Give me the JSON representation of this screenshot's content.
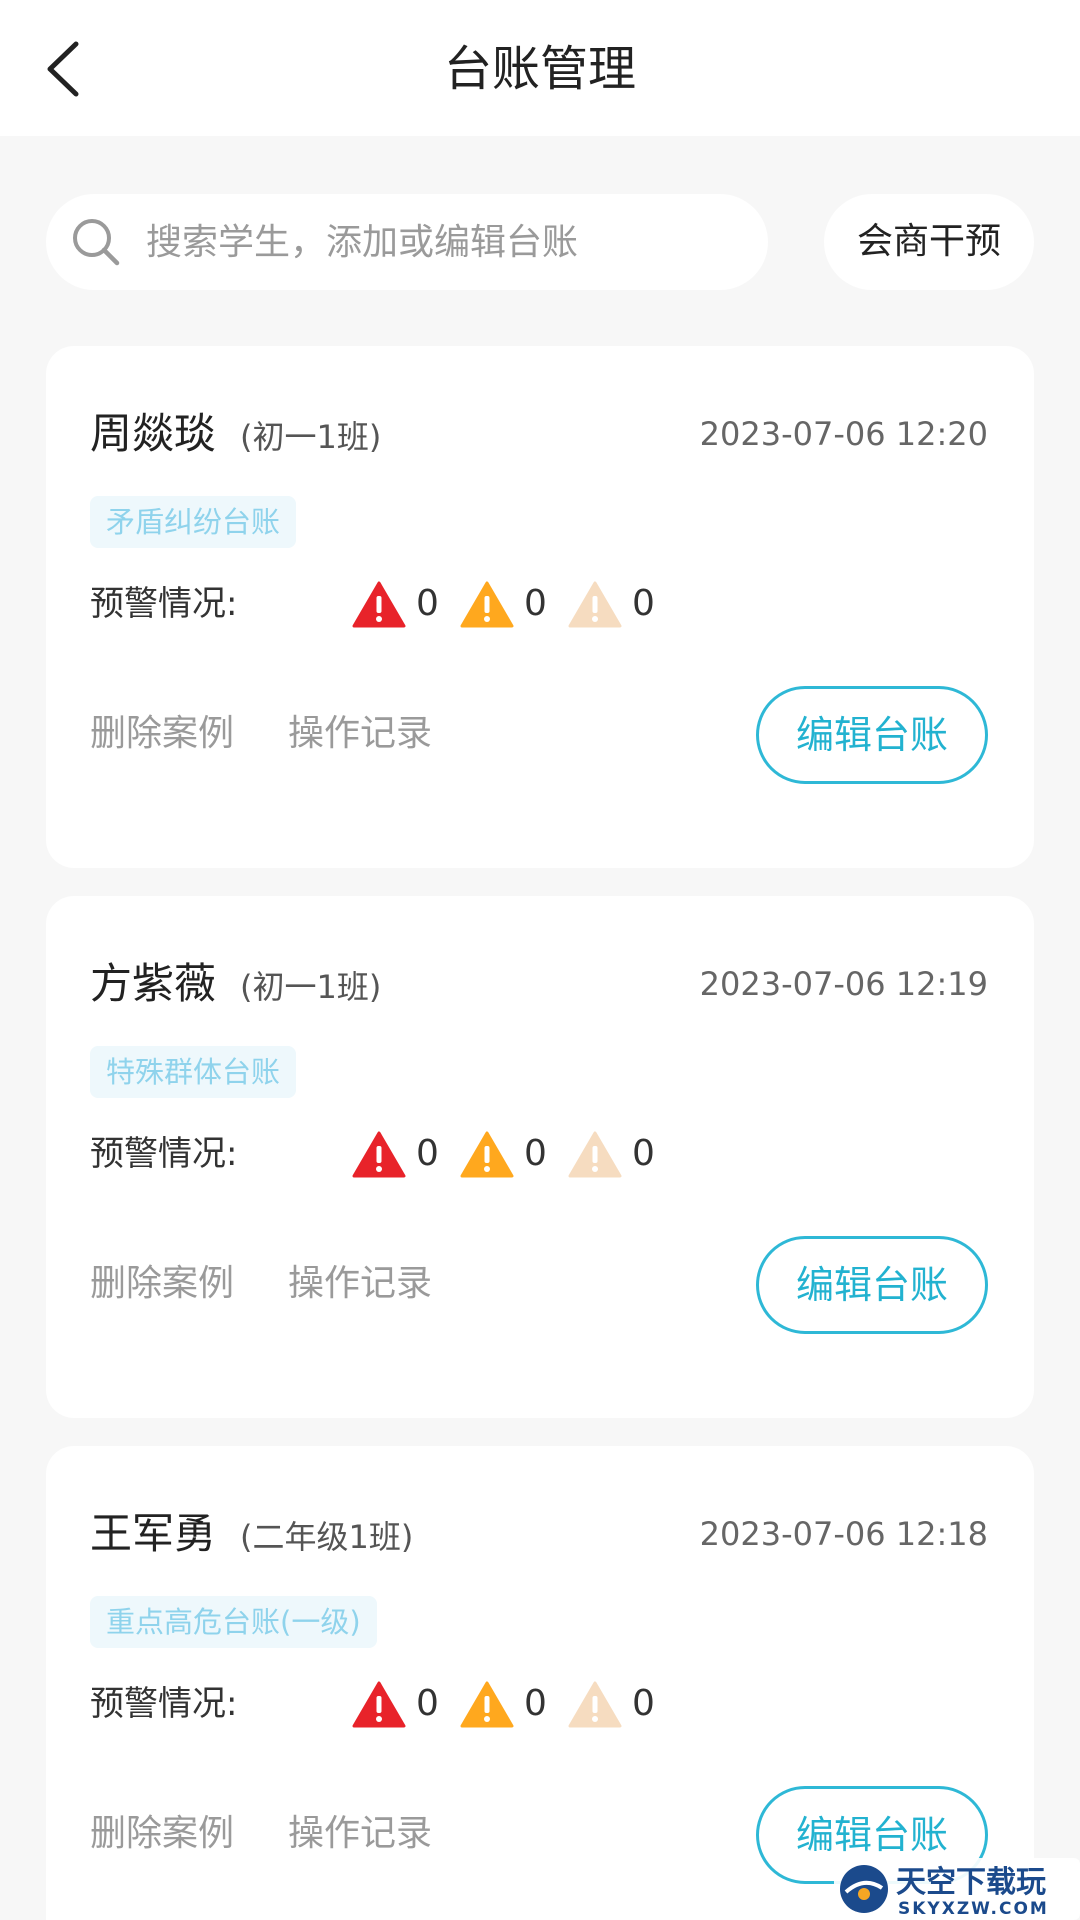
{
  "header": {
    "title": "台账管理"
  },
  "search": {
    "placeholder": "搜索学生，添加或编辑台账",
    "value": ""
  },
  "consult_label": "会商干预",
  "warning_label": "预警情况:",
  "actions": {
    "delete_label": "删除案例",
    "log_label": "操作记录",
    "edit_label": "编辑台账"
  },
  "colors": {
    "warn_high": "#e8232a",
    "warn_mid": "#ffa81e",
    "warn_low": "#f6dcc0",
    "accent": "#2eb8d6",
    "tag_text": "#8fd3ec"
  },
  "cards": [
    {
      "name": "周燚琰",
      "class": "(初一1班)",
      "time": "2023-07-06 12:20",
      "tag": "矛盾纠纷台账",
      "warnings": {
        "high": "0",
        "mid": "0",
        "low": "0"
      }
    },
    {
      "name": "方紫薇",
      "class": "(初一1班)",
      "time": "2023-07-06 12:19",
      "tag": "特殊群体台账",
      "warnings": {
        "high": "0",
        "mid": "0",
        "low": "0"
      }
    },
    {
      "name": "王军勇",
      "class": "(二年级1班)",
      "time": "2023-07-06 12:18",
      "tag": "重点高危台账(一级)",
      "warnings": {
        "high": "0",
        "mid": "0",
        "low": "0"
      }
    }
  ],
  "watermark": {
    "title": "天空下载玩",
    "url": "SKYXZW.COM"
  }
}
